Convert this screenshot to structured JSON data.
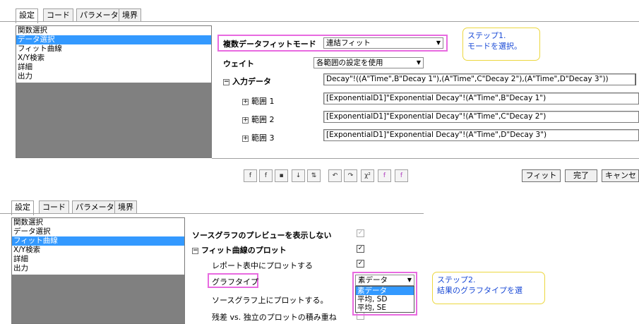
{
  "top": {
    "tabs": [
      "設定",
      "コード",
      "パラメータ",
      "境界"
    ],
    "sidebar": [
      "関数選択",
      "データ選択",
      "フィット曲線",
      "X/Y検索",
      "詳細",
      "出力"
    ],
    "fields": {
      "multi_mode_label": "複数データフィットモード",
      "multi_mode_value": "連結フィット",
      "weight_label": "ウェイト",
      "weight_value": "各範囲の設定を使用",
      "input_label": "入力データ",
      "input_value": "Decay\"!((A\"Time\",B\"Decay 1\"),(A\"Time\",C\"Decay 2\"),(A\"Time\",D\"Decay 3\"))",
      "ranges": [
        {
          "label": "範囲 1",
          "value": "[ExponentialD1]\"Exponential Decay\"!(A\"Time\",B\"Decay 1\")"
        },
        {
          "label": "範囲 2",
          "value": "[ExponentialD1]\"Exponential Decay\"!(A\"Time\",C\"Decay 2\")"
        },
        {
          "label": "範囲 3",
          "value": "[ExponentialD1]\"Exponential Decay\"!(A\"Time\",D\"Decay 3\")"
        }
      ]
    },
    "callout": {
      "line1": "ステップ1.",
      "line2": "モードを選択。"
    },
    "buttons": {
      "fit": "フィット",
      "done": "完了",
      "cancel": "キャンセ"
    },
    "toolbar_icons": [
      "fx-icon",
      "fit-func-icon",
      "save-icon",
      "down-icon",
      "tree-icon",
      "undo-icon",
      "redo-icon",
      "chi-square-icon",
      "iterate-icon",
      "iterate-until-converged-icon"
    ]
  },
  "bottom": {
    "tabs": [
      "設定",
      "コード",
      "パラメータ",
      "境界"
    ],
    "sidebar": [
      "関数選択",
      "データ選択",
      "フィット曲線",
      "X/Y検索",
      "詳細",
      "出力"
    ],
    "rows": {
      "no_preview": "ソースグラフのプレビューを表示しない",
      "plot_fit": "フィット曲線のプロット",
      "plot_in_report": "レポート表中にプロットする",
      "graph_type": "グラフタイプ",
      "plot_on_source": "ソースグラフ上にプロットする。",
      "stack_residual": "残差 vs. 独立のプロットの積み重ね"
    },
    "dropdown": {
      "selected": "素データ",
      "options": [
        "素データ",
        "平均, SD",
        "平均, SE"
      ]
    },
    "callout": {
      "line1": "ステップ2.",
      "line2": "結果のグラフタイプを選"
    }
  },
  "colors": {
    "selection": "#3399ff",
    "callout_border": "#ecd73e",
    "callout_text": "#1a4ad6",
    "highlight_border": "#e86ae0"
  }
}
